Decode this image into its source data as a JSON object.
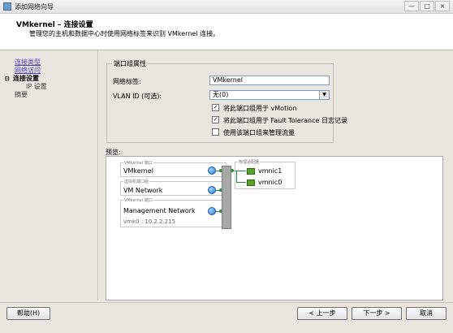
{
  "window": {
    "title": "添加网络向导",
    "controls": [
      "—",
      "□",
      "×"
    ]
  },
  "header": {
    "title": "VMkernel – 连接设置",
    "subtitle": "管理您的主机和数据中心时使用网络标签来识别 VMkernel 连接。"
  },
  "nav": {
    "items": [
      {
        "label": "连接类型"
      },
      {
        "label": "网络访问"
      },
      {
        "label": "连接设置"
      },
      {
        "label": "IP 设置"
      },
      {
        "label": "摘要"
      }
    ]
  },
  "port_group": {
    "legend": "端口组属性",
    "network_label_label": "网络标签:",
    "network_label_value": "VMkernel",
    "vlan_label": "VLAN ID (可选):",
    "vlan_value": "无(0)",
    "options": [
      {
        "label": "将此端口组用于 vMotion",
        "checked": true
      },
      {
        "label": "将此端口组用于 Fault Tolerance 日志记录",
        "checked": true
      },
      {
        "label": "使用该端口组来管理流量",
        "checked": false
      }
    ]
  },
  "preview": {
    "label": "预览:",
    "port_groups": [
      {
        "caption": "VMkernel 端口",
        "name": "VMkernel",
        "detail": ""
      },
      {
        "caption": "虚拟机端口组",
        "name": "VM Network",
        "detail": ""
      },
      {
        "caption": "VMkernel 端口",
        "name": "Management Network",
        "detail": "vmk0 : 10.2.2.215"
      }
    ],
    "adapters": {
      "caption": "物理适配器",
      "nics": [
        "vmnic1",
        "vmnic0"
      ]
    }
  },
  "buttons": {
    "help": "帮助(H)",
    "back": "< 上一步",
    "next": "下一步 >",
    "cancel": "取消"
  },
  "colors": {
    "link": "#4b3fb4",
    "connector": "#2e8b3e",
    "nic": "#5aa02c"
  }
}
